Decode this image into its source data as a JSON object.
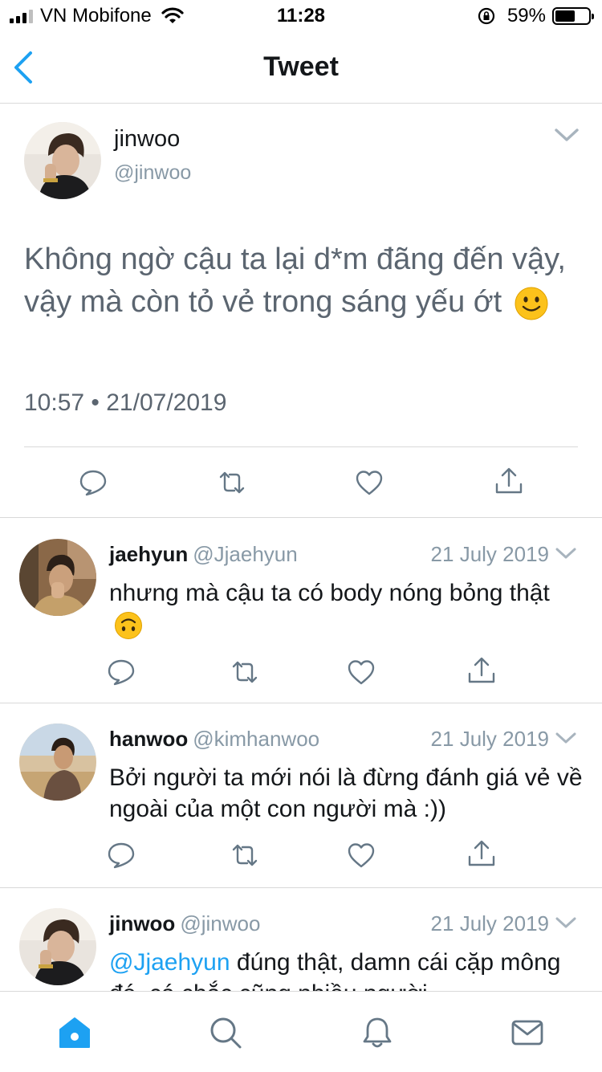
{
  "status_bar": {
    "carrier": "VN Mobifone",
    "time": "11:28",
    "battery_percent": "59%",
    "battery_level": 0.59
  },
  "nav": {
    "title": "Tweet",
    "back_icon": "chevron-left-icon"
  },
  "main_tweet": {
    "name": "jinwoo",
    "handle": "@jinwoo",
    "text": "Không ngờ cậu ta lại d*m đãng đến vậy, vậy mà còn tỏ vẻ trong sáng yếu ớt",
    "emoji": "slightly-smiling-face",
    "timestamp": "10:57 • 21/07/2019"
  },
  "replies": [
    {
      "name": "jaehyun",
      "handle": "@Jjaehyun",
      "date": "21 July 2019",
      "text": "nhưng mà cậu ta có body nóng bỏng thật",
      "emoji": "upside-down-face"
    },
    {
      "name": "hanwoo",
      "handle": "@kimhanwoo",
      "date": "21 July 2019",
      "text": "Bởi người ta mới nói là đừng đánh giá vẻ về ngoài của một con người mà :))"
    },
    {
      "name": "jinwoo",
      "handle": "@jinwoo",
      "date": "21 July 2019",
      "mention": "@Jjaehyun",
      "text": " đúng thật, damn cái cặp mông đó, cá chắc cũng nhiều người"
    }
  ],
  "colors": {
    "accent": "#1da1f2",
    "muted": "#8899a6",
    "text": "#14171a",
    "divider": "#d9d9d9"
  },
  "tab_icons": [
    "home-icon",
    "search-icon",
    "notifications-icon",
    "messages-icon"
  ]
}
